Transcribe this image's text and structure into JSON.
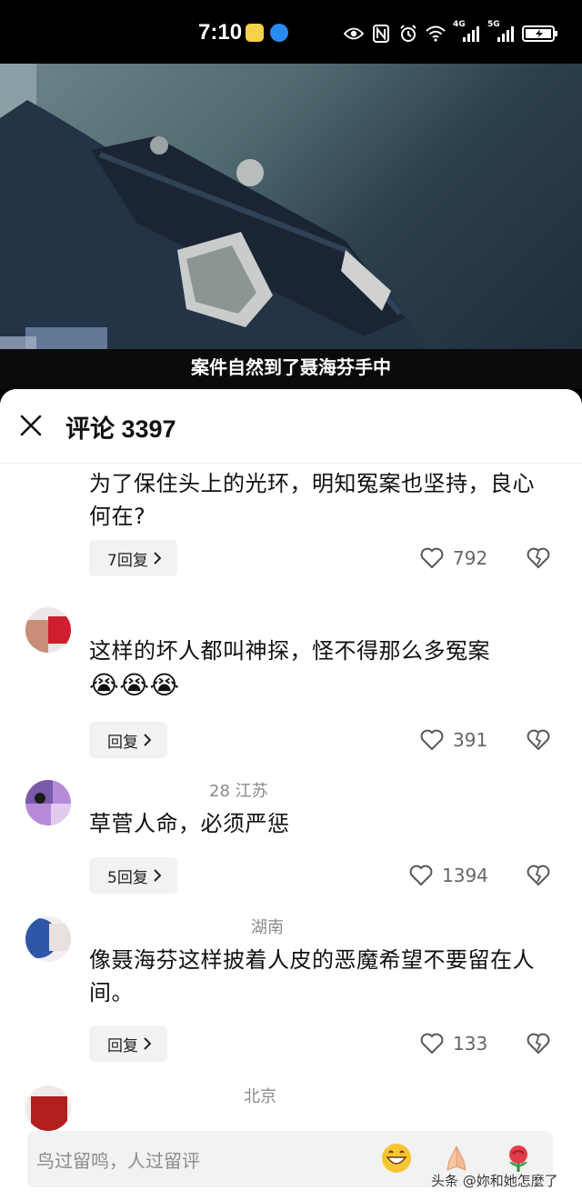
{
  "status_bar": {
    "time": "7:10",
    "network_1": "4G",
    "network_2": "5G"
  },
  "video": {
    "subtitle": "案件自然到了聂海芬手中"
  },
  "comments_panel": {
    "title": "评论 3397",
    "close_icon": "close-icon",
    "comments": [
      {
        "meta": "",
        "text": "为了保住头上的光环，明知冤案也坚持，良心何在?",
        "reply_label": "7回复",
        "likes": "792"
      },
      {
        "meta": "",
        "text": "这样的坏人都叫神探，怪不得那么多冤案",
        "emoji_text": "😭😭😭",
        "reply_label": "回复",
        "likes": "391"
      },
      {
        "meta": "28  江苏",
        "text": "草菅人命，必须严惩",
        "reply_label": "5回复",
        "likes": "1394"
      },
      {
        "meta": "湖南",
        "text": "像聂海芬这样披着人皮的恶魔希望不要留在人间。",
        "reply_label": "回复",
        "likes": "133"
      },
      {
        "meta": "北京",
        "text": ""
      }
    ],
    "input": {
      "placeholder": "鸟过留鸣，人过留评",
      "emojis": [
        "grinning-face-icon",
        "folded-hands-icon",
        "rose-icon"
      ]
    }
  },
  "watermark": "头条 @妳和她怎麼了",
  "colors": {
    "sheet_bg": "#ffffff",
    "reply_bg": "#f2f2f2",
    "meta_text": "#8a8a8a"
  }
}
